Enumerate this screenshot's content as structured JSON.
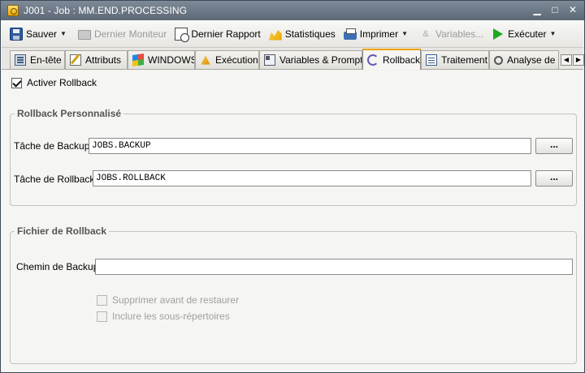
{
  "window": {
    "title": "J001 - Job : MM.END.PROCESSING",
    "controls": {
      "minimize": "▁",
      "maximize": "□",
      "close": "✕"
    }
  },
  "toolbar": {
    "save_label": "Sauver",
    "last_monitor_label": "Dernier Moniteur",
    "last_report_label": "Dernier Rapport",
    "statistics_label": "Statistiques",
    "print_label": "Imprimer",
    "variables_label": "Variables...",
    "execute_label": "Exécuter",
    "dropdown_glyph": "▼"
  },
  "tabs": {
    "items": [
      {
        "label": "En-tête",
        "icon": "header-icon"
      },
      {
        "label": "Attributs",
        "icon": "attributes-icon"
      },
      {
        "label": "WINDOWS",
        "icon": "windows-icon"
      },
      {
        "label": "Exécution",
        "icon": "execution-icon"
      },
      {
        "label": "Variables & Prompts",
        "icon": "variables-icon"
      },
      {
        "label": "Rollback",
        "icon": "rollback-icon",
        "active": true
      },
      {
        "label": "Traitement",
        "icon": "processing-icon"
      },
      {
        "label": "Analyse de r",
        "icon": "analysis-icon"
      }
    ],
    "scroll_left": "◀",
    "scroll_right": "▶"
  },
  "rollback": {
    "enable_label": "Activer Rollback",
    "enable_checked": true,
    "custom_group": {
      "title": "Rollback Personnalisé",
      "backup_task_label": "Tâche de Backup:",
      "backup_task_value": "JOBS.BACKUP",
      "rollback_task_label": "Tâche de Rollback:",
      "rollback_task_value": "JOBS.ROLLBACK",
      "browse_label": "..."
    },
    "file_group": {
      "title": "Fichier de Rollback",
      "backup_path_label": "Chemin de Backup:",
      "backup_path_value": "",
      "delete_before_restore_label": "Supprimer avant de restaurer",
      "include_subdirs_label": "Inclure les sous-répertoires"
    }
  }
}
